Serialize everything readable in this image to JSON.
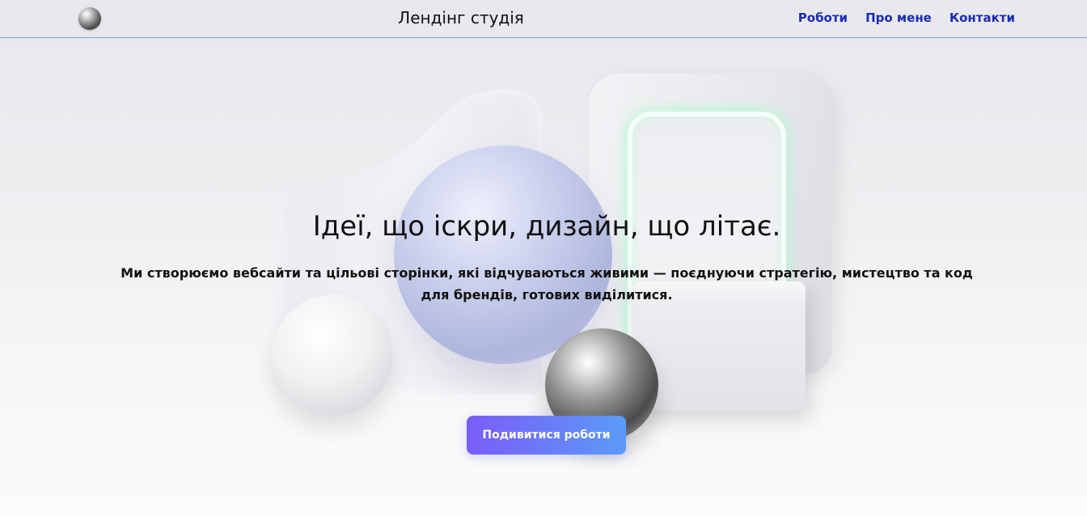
{
  "header": {
    "title": "Лендінг студія",
    "logo_icon": "metal-sphere-icon",
    "nav": [
      {
        "label": "Роботи"
      },
      {
        "label": "Про мене"
      },
      {
        "label": "Контакти"
      }
    ]
  },
  "hero": {
    "title": "Ідеї, що іскри, дизайн, що літає.",
    "subtitle": "Ми створюємо вебсайти та цільові сторінки, які відчуваються живими — поєднуючи стратегію, мистецтво та код для брендів, готових виділитися.",
    "cta_label": "Подивитися роботи"
  },
  "colors": {
    "nav_link": "#1a2bb5",
    "cta_gradient_start": "#7b5cf8",
    "cta_gradient_end": "#5a9bf7",
    "header_border": "#8ea4cf"
  }
}
